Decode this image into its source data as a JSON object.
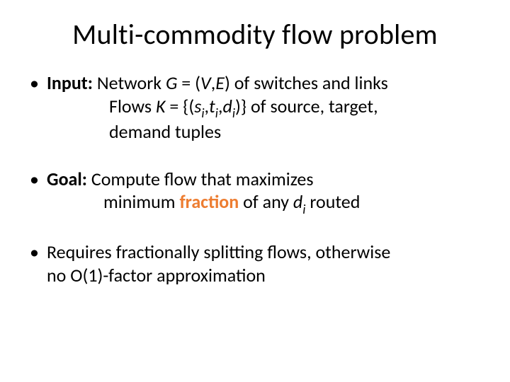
{
  "title": "Multi-commodity flow problem",
  "bullets": {
    "input": {
      "label": "Input:",
      "line1_a": "Network ",
      "line1_G": "G",
      "line1_b": " = (",
      "line1_V": "V",
      "line1_c": ",",
      "line1_E": "E",
      "line1_d": ") of switches and links",
      "line2_a": "Flows ",
      "line2_K": "K",
      "line2_b": " = {(",
      "line2_s": "s",
      "line2_i1": "i",
      "line2_c": ",",
      "line2_t": "t",
      "line2_i2": "i",
      "line2_d": ",",
      "line2_dd": "d",
      "line2_i3": "i",
      "line2_e": ")} of source, target,",
      "line3": "demand tuples"
    },
    "goal": {
      "label": "Goal:",
      "line1": "Compute flow that maximizes",
      "line2_a": "minimum ",
      "line2_frac": "fraction",
      "line2_b": " of any ",
      "line2_d": "d",
      "line2_i": "i",
      "line2_c": " routed"
    },
    "req": {
      "line1": "Requires fractionally splitting flows, otherwise",
      "line2": "no O(1)-factor approximation"
    }
  }
}
